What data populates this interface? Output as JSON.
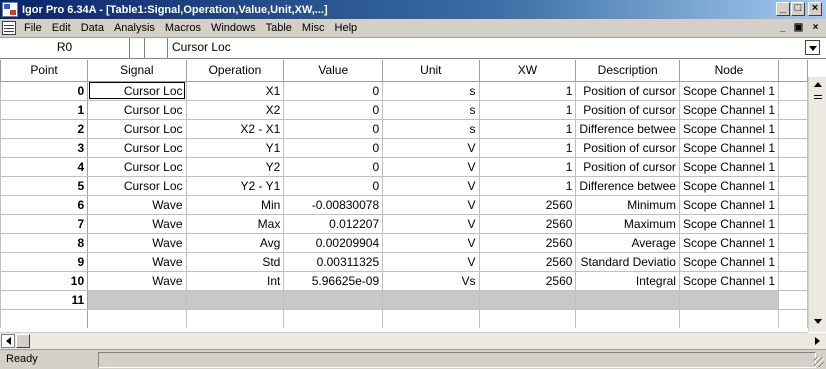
{
  "window": {
    "title": "Igor Pro 6.34A - [Table1:Signal,Operation,Value,Unit,XW,...]"
  },
  "window_controls": [
    "_",
    "□",
    "×"
  ],
  "doc_controls": [
    "_",
    "▣",
    "×"
  ],
  "menu": [
    "File",
    "Edit",
    "Data",
    "Analysis",
    "Macros",
    "Windows",
    "Table",
    "Misc",
    "Help"
  ],
  "entry": {
    "cell_id": "R0",
    "value": "Cursor Loc"
  },
  "table": {
    "columns": [
      "Point",
      "Signal",
      "Operation",
      "Value",
      "Unit",
      "XW",
      "Description",
      "Node"
    ],
    "rows": [
      {
        "point": "0",
        "signal": "Cursor Loc",
        "operation": "X1",
        "value": "0",
        "unit": "s",
        "xw": "1",
        "description": "Position of cursor",
        "node": "Scope Channel 1"
      },
      {
        "point": "1",
        "signal": "Cursor Loc",
        "operation": "X2",
        "value": "0",
        "unit": "s",
        "xw": "1",
        "description": "Position of cursor",
        "node": "Scope Channel 1"
      },
      {
        "point": "2",
        "signal": "Cursor Loc",
        "operation": "X2 - X1",
        "value": "0",
        "unit": "s",
        "xw": "1",
        "description": "Difference betwee",
        "node": "Scope Channel 1"
      },
      {
        "point": "3",
        "signal": "Cursor Loc",
        "operation": "Y1",
        "value": "0",
        "unit": "V",
        "xw": "1",
        "description": "Position of cursor",
        "node": "Scope Channel 1"
      },
      {
        "point": "4",
        "signal": "Cursor Loc",
        "operation": "Y2",
        "value": "0",
        "unit": "V",
        "xw": "1",
        "description": "Position of cursor",
        "node": "Scope Channel 1"
      },
      {
        "point": "5",
        "signal": "Cursor Loc",
        "operation": "Y2 - Y1",
        "value": "0",
        "unit": "V",
        "xw": "1",
        "description": "Difference betwee",
        "node": "Scope Channel 1"
      },
      {
        "point": "6",
        "signal": "Wave",
        "operation": "Min",
        "value": "-0.00830078",
        "unit": "V",
        "xw": "2560",
        "description": "Minimum",
        "node": "Scope Channel 1"
      },
      {
        "point": "7",
        "signal": "Wave",
        "operation": "Max",
        "value": "0.012207",
        "unit": "V",
        "xw": "2560",
        "description": "Maximum",
        "node": "Scope Channel 1"
      },
      {
        "point": "8",
        "signal": "Wave",
        "operation": "Avg",
        "value": "0.00209904",
        "unit": "V",
        "xw": "2560",
        "description": "Average",
        "node": "Scope Channel 1"
      },
      {
        "point": "9",
        "signal": "Wave",
        "operation": "Std",
        "value": "0.00311325",
        "unit": "V",
        "xw": "2560",
        "description": "Standard Deviatio",
        "node": "Scope Channel 1"
      },
      {
        "point": "10",
        "signal": "Wave",
        "operation": "Int",
        "value": "5.96625e-09",
        "unit": "Vs",
        "xw": "2560",
        "description": "Integral",
        "node": "Scope Channel 1"
      }
    ],
    "new_row_point": "11"
  },
  "status": {
    "text": "Ready"
  }
}
